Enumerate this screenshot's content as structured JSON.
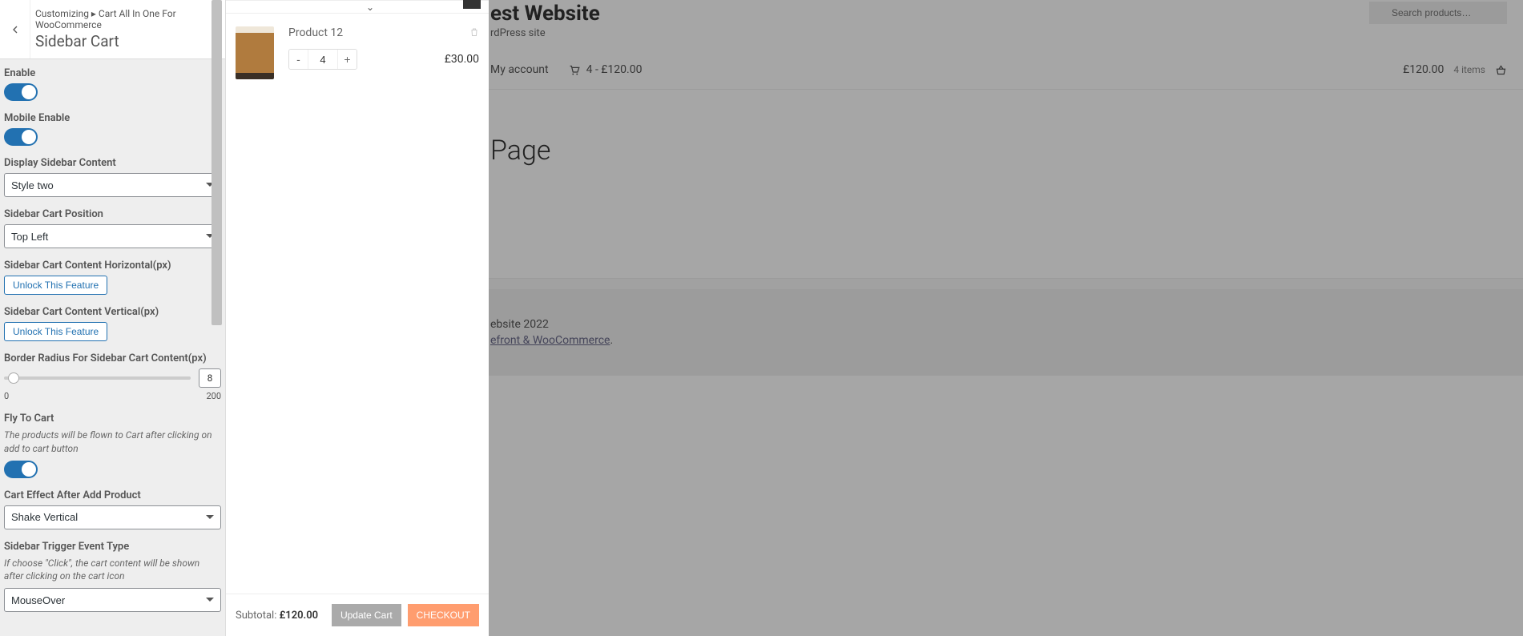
{
  "customizer": {
    "breadcrumb": "Customizing ▸ Cart All In One For WooCommerce",
    "section_title": "Sidebar Cart",
    "enable_label": "Enable",
    "mobile_enable_label": "Mobile Enable",
    "display_sidebar_content_label": "Display Sidebar Content",
    "display_sidebar_content_value": "Style two",
    "sidebar_cart_position_label": "Sidebar Cart Position",
    "sidebar_cart_position_value": "Top Left",
    "horizontal_label": "Sidebar Cart Content Horizontal(px)",
    "vertical_label": "Sidebar Cart Content Vertical(px)",
    "unlock_label": "Unlock This Feature",
    "border_radius_label": "Border Radius For Sidebar Cart Content(px)",
    "border_radius_value": "8",
    "border_radius_min": "0",
    "border_radius_max": "200",
    "fly_to_cart_label": "Fly To Cart",
    "fly_to_cart_desc": "The products will be flown to Cart after clicking on add to cart button",
    "cart_effect_label": "Cart Effect After Add Product",
    "cart_effect_value": "Shake Vertical",
    "trigger_label": "Sidebar Trigger Event Type",
    "trigger_desc": "If choose \"Click\", the cart content will be shown after clicking on the cart icon",
    "trigger_value": "MouseOver"
  },
  "sidebar_cart": {
    "item_name": "Product 12",
    "item_qty": "4",
    "item_price": "£30.00",
    "subtotal_label": "Subtotal:",
    "subtotal_value": "£120.00",
    "update_label": "Update Cart",
    "checkout_label": "CHECKOUT",
    "minus": "-",
    "plus": "+"
  },
  "site": {
    "title_fragment": "est Website",
    "tagline_fragment": "rdPress site",
    "search_placeholder": "Search products…",
    "nav_my_account": "My account",
    "nav_cart_text": "4 - £120.00",
    "nav_price": "£120.00",
    "nav_items": "4 items",
    "page_title_fragment": "Page",
    "footer_line1_fragment": "ebsite 2022",
    "footer_link_fragment": "efront & WooCommerce",
    "footer_period": "."
  }
}
